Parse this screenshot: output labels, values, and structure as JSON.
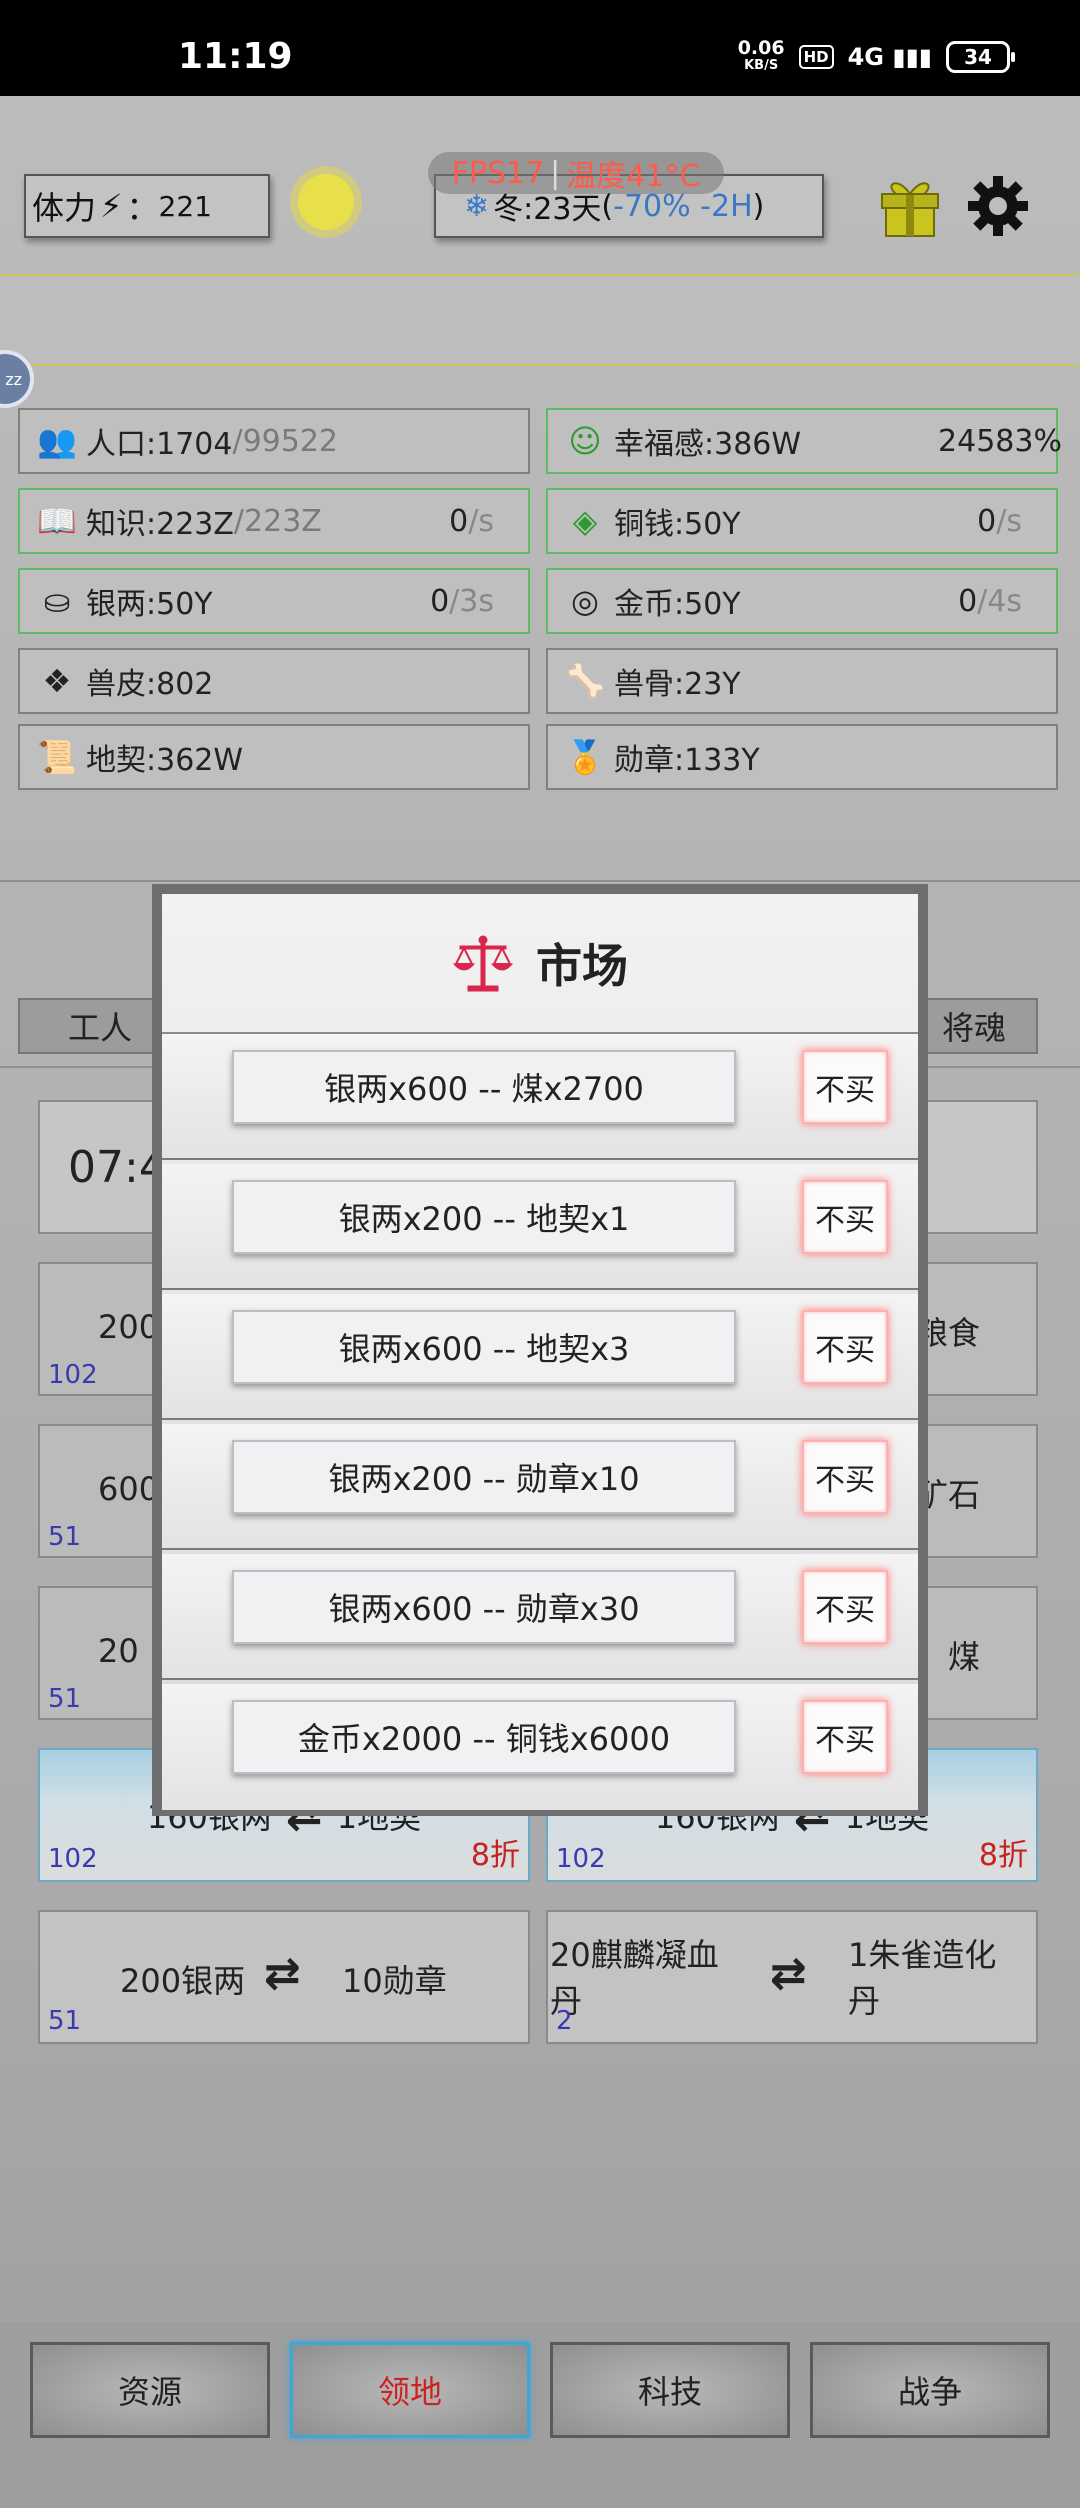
{
  "status_bar": {
    "time": "11:19",
    "net_speed": "0.06",
    "net_unit": "KB/S",
    "hd": "HD",
    "signal": "4G",
    "battery": "34"
  },
  "top": {
    "stamina_label": "体力",
    "stamina_sep": "：",
    "stamina_value": "221",
    "fps": "FPS17",
    "temperature": "温度41°C",
    "season_text": "冬:23天",
    "season_open": " (",
    "season_modifier": "-70% -2H",
    "season_close": ")"
  },
  "side_badge": "zz",
  "resources": [
    {
      "label": "人口:1704",
      "extra": "/99522",
      "rate": "",
      "rate_dim": ""
    },
    {
      "label": "幸福感:386W",
      "extra": "",
      "rate": "24583%",
      "rate_dim": ""
    },
    {
      "label": "知识:223Z",
      "extra": "/223Z",
      "rate": "0",
      "rate_dim": "/s"
    },
    {
      "label": "铜钱:50Y",
      "extra": "",
      "rate": "0",
      "rate_dim": "/s"
    },
    {
      "label": "银两:50Y",
      "extra": "",
      "rate": "0",
      "rate_dim": "/3s"
    },
    {
      "label": "金币:50Y",
      "extra": "",
      "rate": "0",
      "rate_dim": "/4s"
    },
    {
      "label": "兽皮:802",
      "extra": "",
      "rate": "",
      "rate_dim": ""
    },
    {
      "label": "兽骨:23Y",
      "extra": "",
      "rate": "",
      "rate_dim": ""
    },
    {
      "label": "地契:362W",
      "extra": "",
      "rate": "",
      "rate_dim": ""
    },
    {
      "label": "勋章:133Y",
      "extra": "",
      "rate": "",
      "rate_dim": ""
    }
  ],
  "tabs": {
    "worker": "工人",
    "soul": "将魂"
  },
  "timer_text": "07:4",
  "background_trades": [
    {
      "left": "200",
      "right": "粮食",
      "count": "102"
    },
    {
      "left": "600",
      "right": "矿石",
      "count": "51"
    },
    {
      "left": "20",
      "right": "煤",
      "count": "51"
    }
  ],
  "deals": [
    {
      "left": "160银两",
      "right": "1地契",
      "count": "102",
      "discount": "8折"
    },
    {
      "left": "160银两",
      "right": "1地契",
      "count": "102",
      "discount": "8折"
    }
  ],
  "trade_row": [
    {
      "left": "200银两",
      "right": "10勋章",
      "count": "51"
    },
    {
      "left": "20麒麟凝血丹",
      "right": "1朱雀造化丹",
      "count": "2"
    }
  ],
  "nav": [
    "资源",
    "领地",
    "科技",
    "战争"
  ],
  "modal": {
    "title": "市场",
    "offers": [
      {
        "text": "银两x600 -- 煤x2700",
        "button": "不买"
      },
      {
        "text": "银两x200 -- 地契x1",
        "button": "不买"
      },
      {
        "text": "银两x600 -- 地契x3",
        "button": "不买"
      },
      {
        "text": "银两x200 -- 勋章x10",
        "button": "不买"
      },
      {
        "text": "银两x600 -- 勋章x30",
        "button": "不买"
      },
      {
        "text": "金币x2000 -- 铜钱x6000",
        "button": "不买"
      }
    ]
  }
}
